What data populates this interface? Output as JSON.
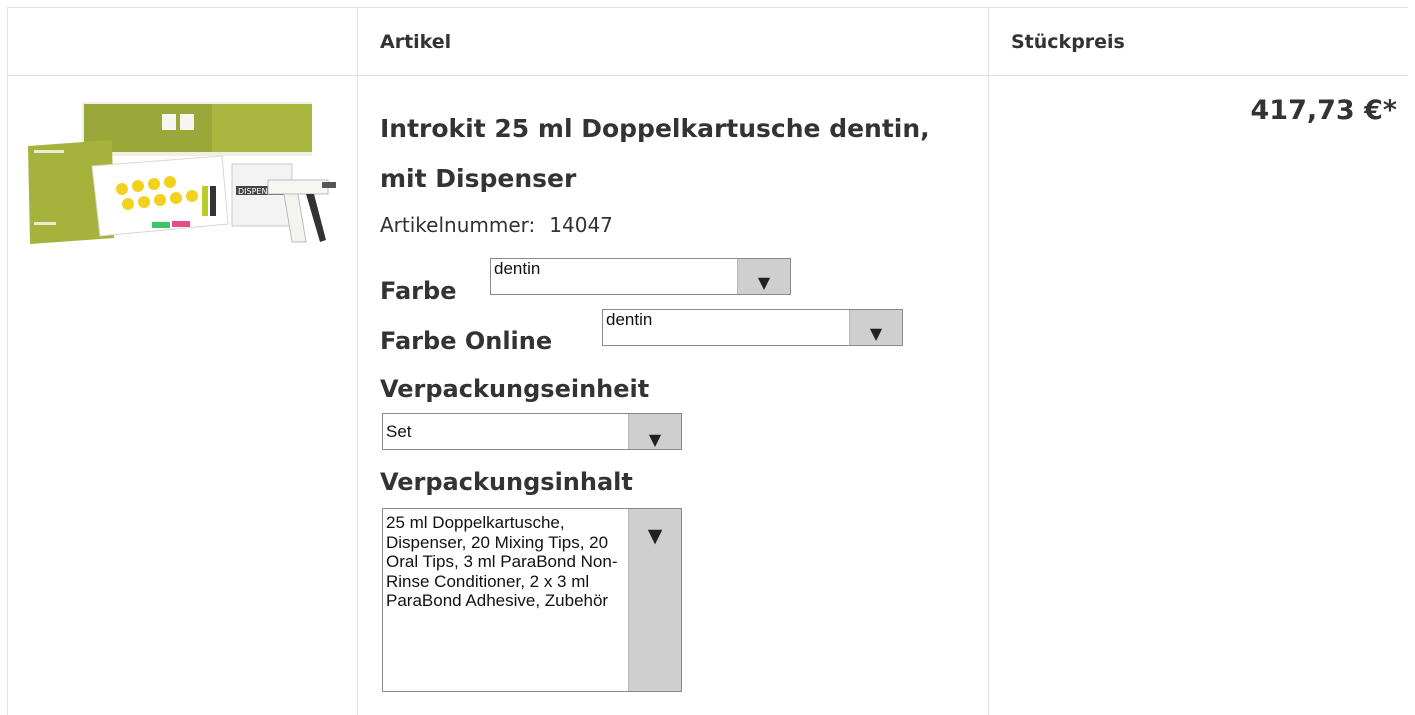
{
  "header": {
    "col_article": "Artikel",
    "col_unit_price": "Stückpreis"
  },
  "product": {
    "title": "Introkit 25 ml Doppelkartusche dentin, mit Dispenser",
    "article_number_label": "Artikelnummer:",
    "article_number": "14047",
    "price": "417,73 €*"
  },
  "options": {
    "farbe_label": "Farbe",
    "farbe_value": "dentin",
    "farbe_online_label": "Farbe Online",
    "farbe_online_value": "dentin",
    "verpackungseinheit_label": "Verpackungseinheit",
    "verpackungseinheit_value": "Set",
    "verpackungsinhalt_label": "Verpackungsinhalt",
    "verpackungsinhalt_value": "25 ml Doppelkartusche, Dispenser, 20 Mixing Tips, 20 Oral Tips, 3 ml ParaBond Non-Rinse Conditioner, 2 x 3 ml ParaBond Adhesive, Zubehör"
  },
  "icons": {
    "dropdown": "triangle-down-icon"
  },
  "colors": {
    "border": "#e2e2e2",
    "select_arrow_bg": "#cfcfcf",
    "text": "#333333"
  }
}
